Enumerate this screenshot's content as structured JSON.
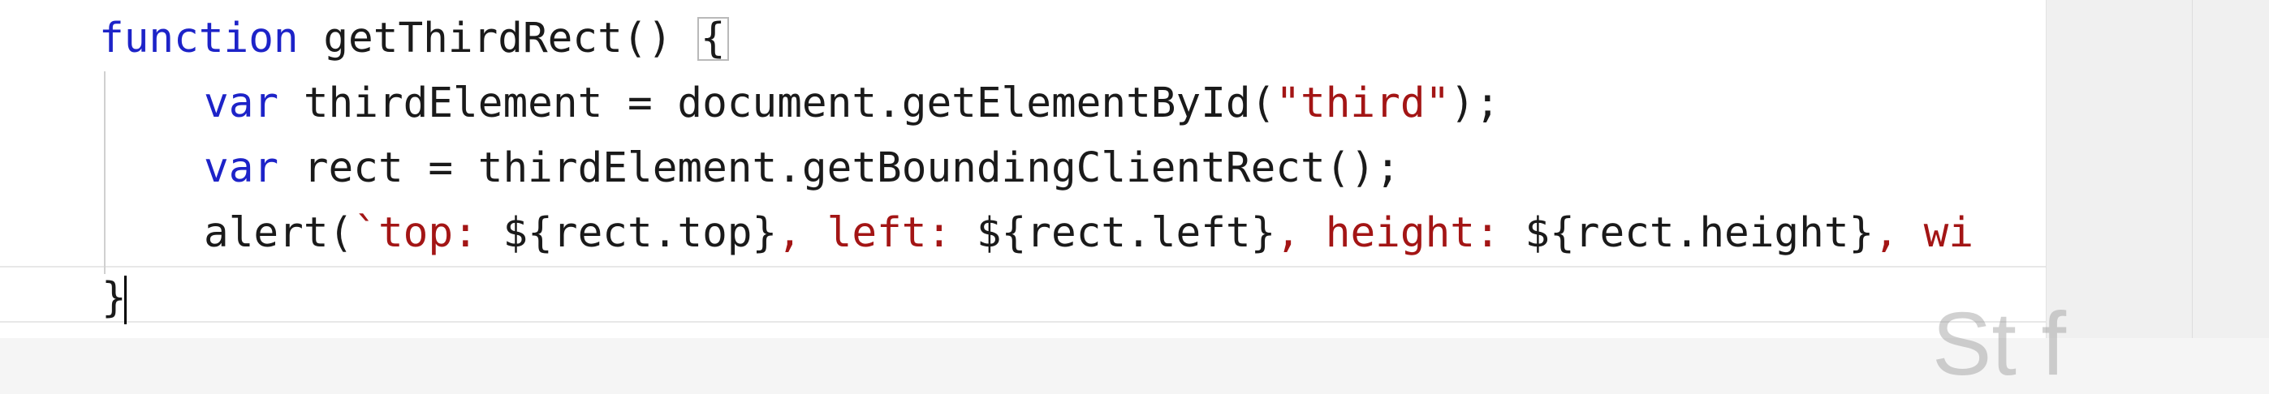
{
  "editor": {
    "lines": [
      {
        "keyword": "function",
        "rest": " getThirdRect() ",
        "brace": "{"
      },
      {
        "keyword": "var",
        "rest_before": " thirdElement = document.getElementById(",
        "string": "\"third\"",
        "rest_after": ");"
      },
      {
        "keyword": "var",
        "rest": " rect = thirdElement.getBoundingClientRect();"
      },
      {
        "start": "alert(",
        "t1": "`top: ",
        "e1": "${rect.top}",
        "t2": ", left: ",
        "e2": "${rect.left}",
        "t3": ", height: ",
        "e3": "${rect.height}",
        "t4": ", wi"
      },
      {
        "brace": "}"
      }
    ]
  },
  "watermark": {
    "text": "St  f"
  },
  "colors": {
    "keyword": "#1d23c8",
    "string": "#a31515",
    "text": "#1a1a1a",
    "background": "#ffffff"
  }
}
